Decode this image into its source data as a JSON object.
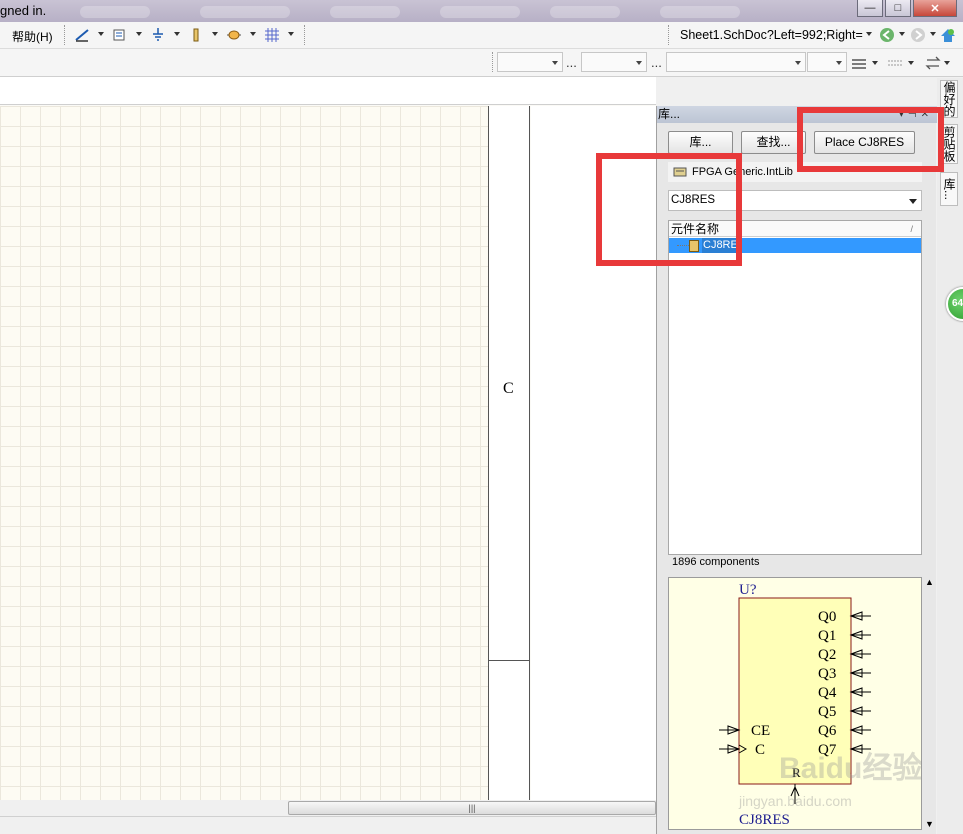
{
  "window": {
    "title_fragment": "gned in.",
    "buttons": {
      "minimize": "—",
      "maximize": "□",
      "close": "✕"
    }
  },
  "menu": {
    "help_label": "帮助(H)"
  },
  "address": {
    "text": "Sheet1.SchDoc?Left=992;Right="
  },
  "toolbar2": {
    "ellipsis": "..."
  },
  "sheet": {
    "zone_label": "C",
    "scroll_grip": "|||"
  },
  "library_panel": {
    "title": "库...",
    "buttons": {
      "libraries": "库...",
      "search": "查找...",
      "place": "Place CJ8RES"
    },
    "library_selector": "FPGA Generic.IntLib",
    "filter_value": "CJ8RES",
    "list_header": "元件名称",
    "sort_indicator": "/",
    "items": [
      {
        "label": "CJ8RE"
      }
    ],
    "count": "1896 components",
    "preview": {
      "designator": "U?",
      "outputs": [
        "Q0",
        "Q1",
        "Q2",
        "Q3",
        "Q4",
        "Q5",
        "Q6",
        "Q7"
      ],
      "inputs": [
        "CE",
        "C"
      ],
      "bottom_pin": "R",
      "part_name": "CJ8RES",
      "watermark": "Baidu经验",
      "watermark_url": "jingyan.baidu.com"
    }
  },
  "side_tabs": {
    "tab1": "偏好的",
    "tab2": "剪贴板",
    "tab3": "库..."
  },
  "badge": {
    "text": "64"
  },
  "colors": {
    "highlight_red": "#e8393a",
    "selection_blue": "#3399ff",
    "schematic_navy": "#1d1d8f",
    "component_fill": "#ffffb8",
    "component_border": "#8a1818"
  }
}
